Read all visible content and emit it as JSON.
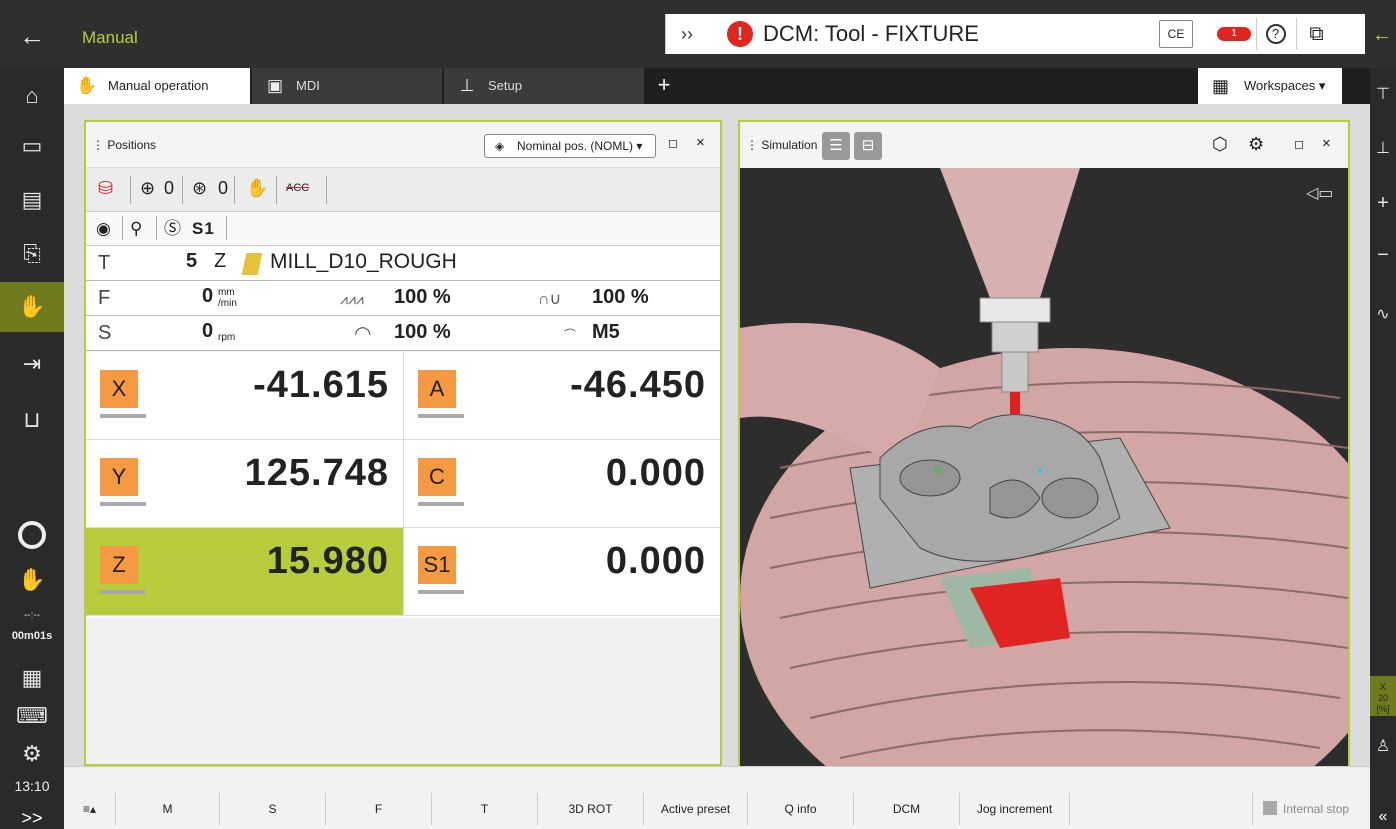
{
  "header": {
    "mode": "Manual",
    "message": "DCM: Tool - FIXTURE",
    "ce_label": "CE",
    "message_count": "1"
  },
  "tabs": [
    {
      "label": "Manual operation"
    },
    {
      "label": "MDI"
    },
    {
      "label": "Setup"
    }
  ],
  "workspaces_label": "Workspaces",
  "positions": {
    "title": "Positions",
    "view_mode": "Nominal pos. (NOML)",
    "status": {
      "datum_count": "0",
      "preset_count": "0",
      "acc_label": "ACC",
      "spindle_label": "S1"
    },
    "tool": {
      "label": "T",
      "number": "5",
      "axis": "Z",
      "name": "MILL_D10_ROUGH"
    },
    "feed": {
      "label": "F",
      "value": "0",
      "unit_top": "mm",
      "unit_bottom": "/min",
      "override_feed": "100 %",
      "override_rapid": "100 %"
    },
    "spindle": {
      "label": "S",
      "value": "0",
      "unit": "rpm",
      "override": "100 %",
      "mfunction": "M5"
    },
    "axes": [
      {
        "name": "X",
        "value": "-41.615"
      },
      {
        "name": "A",
        "value": "-46.450"
      },
      {
        "name": "Y",
        "value": "125.748"
      },
      {
        "name": "C",
        "value": "0.000"
      },
      {
        "name": "Z",
        "value": "15.980"
      },
      {
        "name": "S1",
        "value": "0.000"
      }
    ]
  },
  "simulation": {
    "title": "Simulation"
  },
  "sidebar": {
    "timer_dash": "--:--",
    "timer_value": "00m01s",
    "clock": "13:10",
    "more_label": ">>"
  },
  "rightbar": {
    "axis_line1": "X",
    "axis_line2": "20",
    "axis_line3": "[%]"
  },
  "softkeys": [
    {
      "label": "M"
    },
    {
      "label": "S"
    },
    {
      "label": "F"
    },
    {
      "label": "T"
    },
    {
      "label": "3D ROT"
    },
    {
      "label": "Active preset"
    },
    {
      "label": "Q info"
    },
    {
      "label": "DCM"
    },
    {
      "label": "Jog increment"
    }
  ],
  "internal_stop_label": "Internal stop",
  "colors": {
    "accent": "#b8cc3c",
    "axis_badge": "#f59a42",
    "error": "#e0241e"
  },
  "icons": [
    "back-arrow-icon",
    "home-icon",
    "folder-icon",
    "table-icon",
    "program-run-icon",
    "hand-icon",
    "single-block-icon",
    "setup-icon",
    "calculator-icon",
    "keyboard-icon",
    "settings-icon",
    "help-icon",
    "windows-icon",
    "cube-icon",
    "gear-icon"
  ]
}
